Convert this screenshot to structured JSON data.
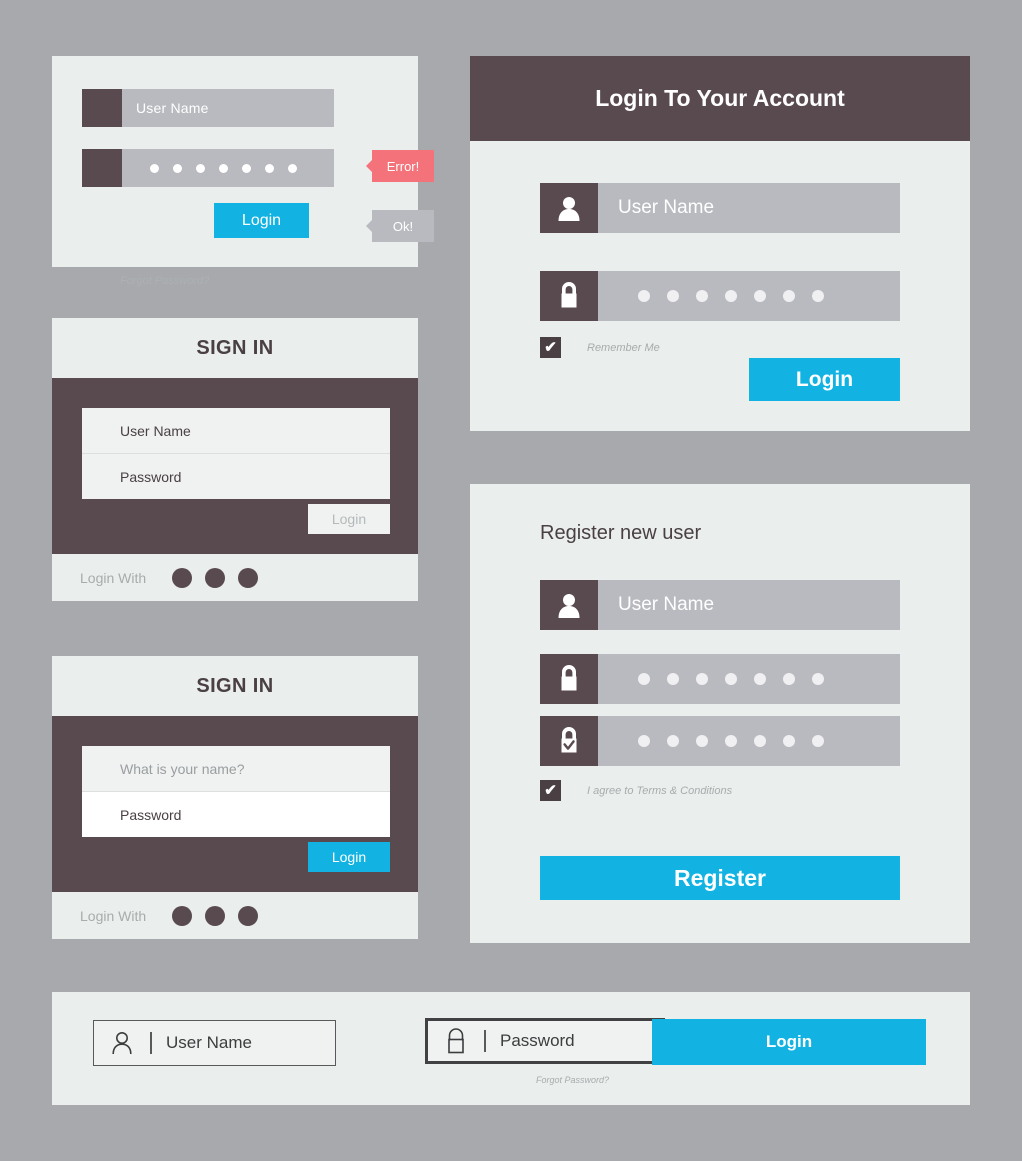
{
  "theme": {
    "background": "#a7a9ac",
    "panel": "#eaeeed",
    "dark": "#594a50",
    "accent_blue": "#12b3e3",
    "field_grey": "#b8babf",
    "error_red": "#f4727a",
    "ok_grey": "#b8babf"
  },
  "card_validation": {
    "username_placeholder": "User Name",
    "password_mask": "•••••••",
    "password_dot_count": 7,
    "error_badge": "Error!",
    "ok_badge": "Ok!",
    "forgot_label": "Forgot Password?",
    "login_label": "Login",
    "user_icon": "user-icon",
    "lock_icon": "lock-icon"
  },
  "signin_basic": {
    "title": "SIGN IN",
    "username_placeholder": "User Name",
    "password_placeholder": "Password",
    "login_label": "Login",
    "login_disabled": true,
    "social_label": "Login With",
    "social_count": 3
  },
  "signin_question": {
    "title": "SIGN IN",
    "username_placeholder": "What is your name?",
    "password_placeholder": "Password",
    "login_label": "Login",
    "login_disabled": false,
    "social_label": "Login With",
    "social_count": 3
  },
  "login_account": {
    "title": "Login To Your Account",
    "username_placeholder": "User Name",
    "password_dot_count": 7,
    "remember_label": "Remember Me",
    "remember_checked": true,
    "check_glyph": "✔",
    "login_label": "Login",
    "user_icon": "user-icon",
    "lock_icon": "lock-icon"
  },
  "register": {
    "title": "Register new user",
    "username_placeholder": "User Name",
    "password_dot_count": 7,
    "confirm_dot_count": 7,
    "terms_label": "I agree to Terms & Conditions",
    "terms_checked": true,
    "check_glyph": "✔",
    "register_label": "Register",
    "user_icon": "user-icon",
    "lock_icon": "lock-icon",
    "lock_check_icon": "lock-check-icon"
  },
  "bottom_bar": {
    "username_placeholder": "User Name",
    "password_placeholder": "Password",
    "forgot_label": "Forgot Password?",
    "login_label": "Login",
    "user_icon": "user-outline-icon",
    "lock_icon": "lock-outline-icon"
  }
}
